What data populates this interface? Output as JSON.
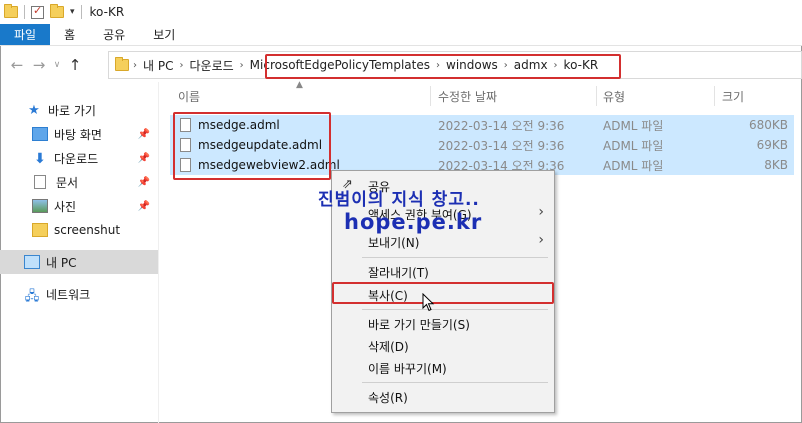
{
  "window": {
    "title": "ko-KR"
  },
  "ribbon": {
    "tabs": [
      "파일",
      "홈",
      "공유",
      "보기"
    ]
  },
  "address": {
    "crumbs": [
      "내 PC",
      "다운로드",
      "MicrosoftEdgePolicyTemplates",
      "windows",
      "admx",
      "ko-KR"
    ]
  },
  "sidebar": {
    "items": [
      {
        "label": "바로 가기",
        "icon": "star-icon"
      },
      {
        "label": "바탕 화면",
        "icon": "desktop-icon"
      },
      {
        "label": "다운로드",
        "icon": "download-icon"
      },
      {
        "label": "문서",
        "icon": "document-icon"
      },
      {
        "label": "사진",
        "icon": "pictures-icon"
      },
      {
        "label": "screenshut",
        "icon": "folder-icon"
      },
      {
        "label": "내 PC",
        "icon": "this-pc-icon"
      },
      {
        "label": "네트워크",
        "icon": "network-icon"
      }
    ]
  },
  "columns": {
    "name": "이름",
    "date": "수정한 날짜",
    "type": "유형",
    "size": "크기"
  },
  "files": [
    {
      "name": "msedge.adml",
      "date": "2022-03-14 오전 9:36",
      "type": "ADML 파일",
      "size": "680KB"
    },
    {
      "name": "msedgeupdate.adml",
      "date": "2022-03-14 오전 9:36",
      "type": "ADML 파일",
      "size": "69KB"
    },
    {
      "name": "msedgewebview2.adml",
      "date": "2022-03-14 오전 9:36",
      "type": "ADML 파일",
      "size": "8KB"
    }
  ],
  "context_menu": {
    "share": "공유",
    "access": "액세스 권한 부여(G)",
    "send_to": "보내기(N)",
    "cut": "잘라내기(T)",
    "copy": "복사(C)",
    "create_shortcut": "바로 가기 만들기(S)",
    "delete": "삭제(D)",
    "rename": "이름 바꾸기(M)",
    "properties": "속성(R)"
  },
  "watermark": {
    "line1": "진범이의 지식 창고..",
    "line2": "hope.pe.kr"
  },
  "colors": {
    "accent": "#1979ca",
    "selection": "#cce8ff",
    "highlight": "#d32f2f",
    "watermark": "#1c2fb3"
  }
}
